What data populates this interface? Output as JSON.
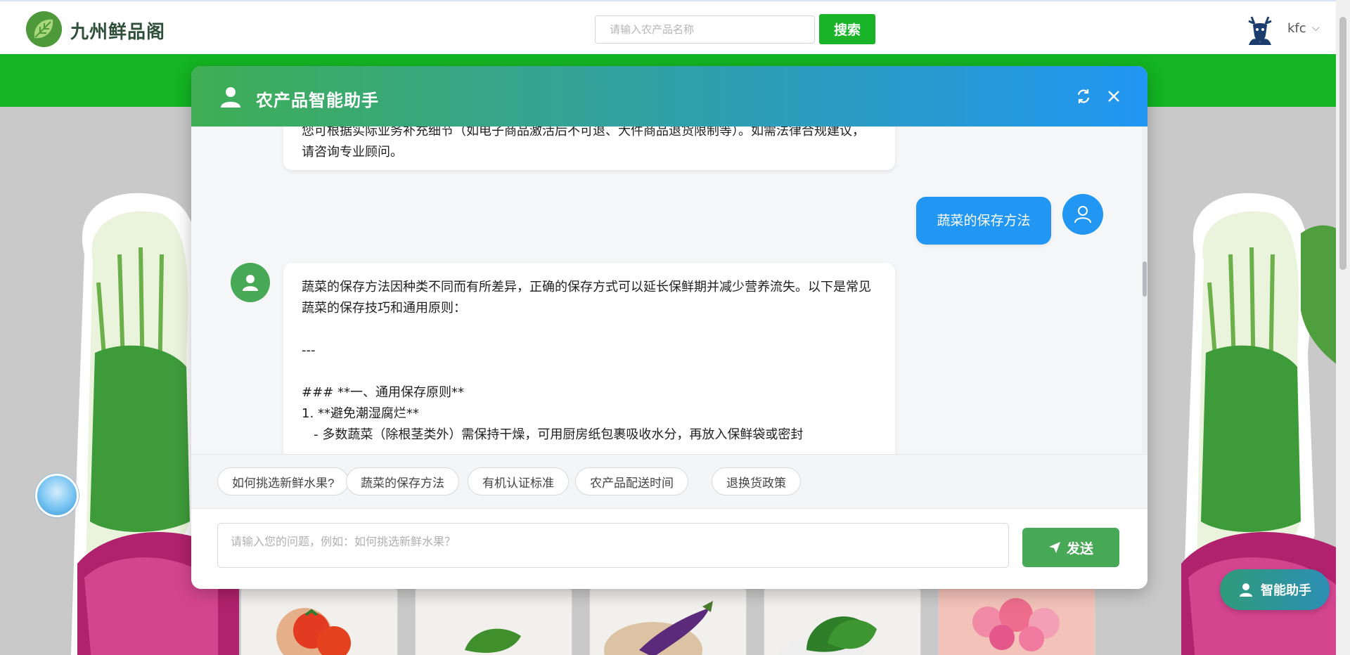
{
  "header": {
    "brand_name": "九州鲜品阁",
    "search_placeholder": "请输入农产品名称",
    "search_button": "搜索",
    "username": "kfc",
    "user_caret": "⌵"
  },
  "assistant": {
    "title": "农产品智能助手",
    "messages": {
      "prev_bot_text": "您可根据实际业务补充细节（如电子商品激活后不可退、大件商品退货限制等）。如需法律合规建议，请咨询专业顾问。",
      "user_text": "蔬菜的保存方法",
      "bot_text": "蔬菜的保存方法因种类不同而有所差异，正确的保存方式可以延长保鲜期并减少营养流失。以下是常见蔬菜的保存技巧和通用原则：\n\n---\n\n### **一、通用保存原则**\n1. **避免潮湿腐烂**\n   - 多数蔬菜（除根茎类外）需保持干燥，可用厨房纸包裹吸收水分，再放入保鲜袋或密封"
    },
    "suggestions": [
      "如何挑选新鲜水果?",
      "蔬菜的保存方法",
      "有机认证标准",
      "农产品配送时间",
      "退换货政策"
    ],
    "input_placeholder": "请输入您的问题，例如：如何挑选新鲜水果？",
    "send_button": "发送"
  },
  "fab_label": "智能助手",
  "colors": {
    "brand_green": "#13b522",
    "assistant_green": "#47a855",
    "user_blue": "#2196f3"
  }
}
